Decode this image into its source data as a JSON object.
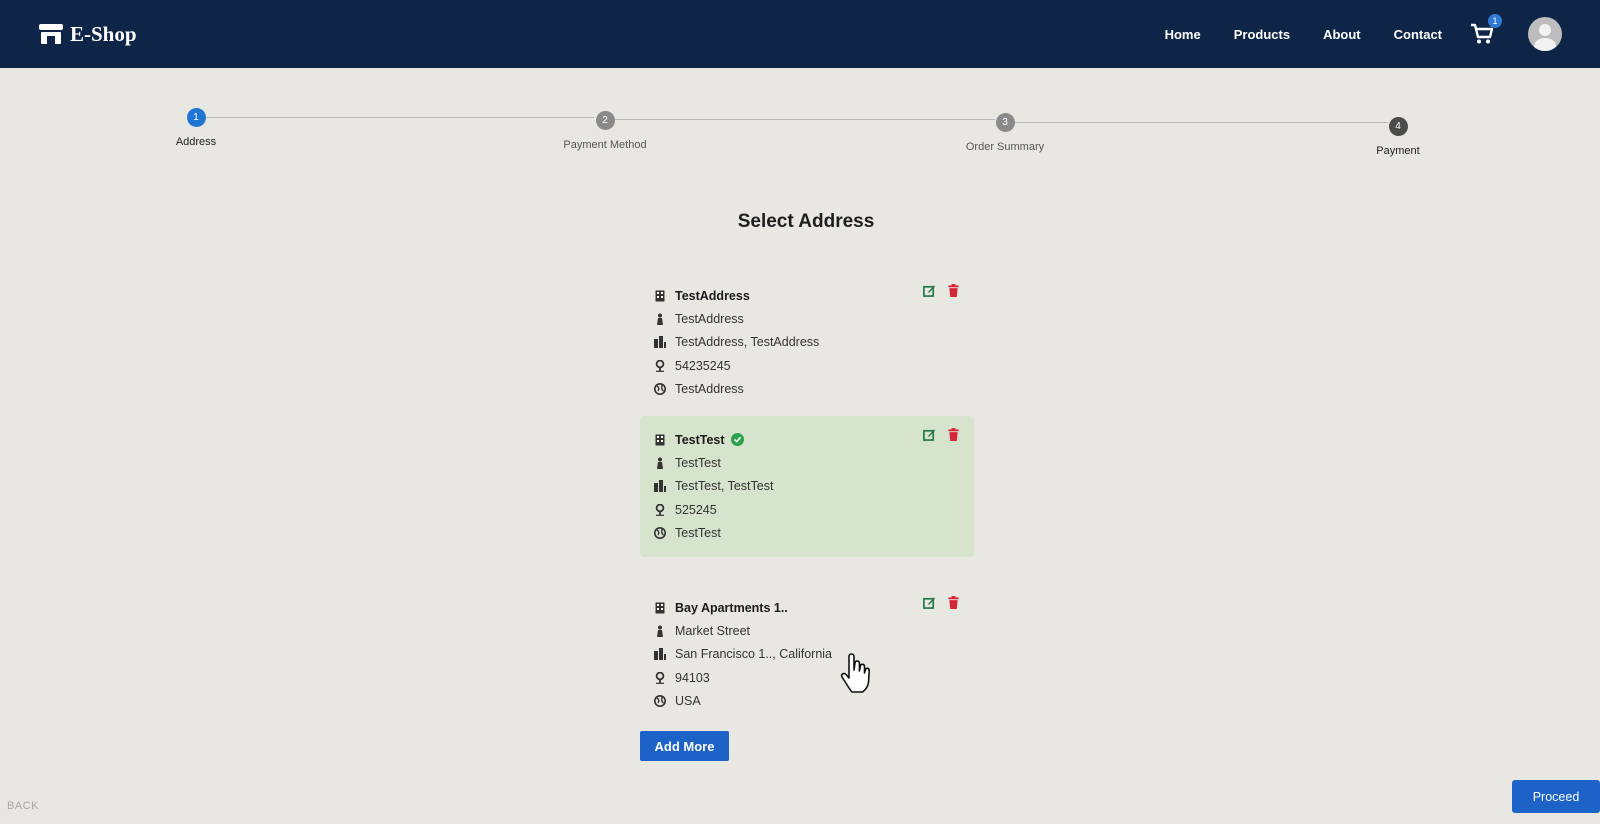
{
  "navbar": {
    "brand": "E-Shop",
    "links": [
      "Home",
      "Products",
      "About",
      "Contact"
    ],
    "cart_count": "1"
  },
  "stepper": {
    "steps": [
      {
        "number": "1",
        "label": "Address"
      },
      {
        "number": "2",
        "label": "Payment Method"
      },
      {
        "number": "3",
        "label": "Order Summary"
      },
      {
        "number": "4",
        "label": "Payment"
      }
    ]
  },
  "main": {
    "title": "Select Address",
    "addresses": [
      {
        "name": "TestAddress",
        "street": "TestAddress",
        "city_state": "TestAddress, TestAddress",
        "zip": "54235245",
        "country": "TestAddress",
        "selected": false
      },
      {
        "name": "TestTest",
        "street": "TestTest",
        "city_state": "TestTest, TestTest",
        "zip": "525245",
        "country": "TestTest",
        "selected": true
      },
      {
        "name": "Bay Apartments 1..",
        "street": "Market Street",
        "city_state": "San Francisco 1.., California",
        "zip": "94103",
        "country": "USA",
        "selected": false
      }
    ],
    "add_more_label": "Add More"
  },
  "footer": {
    "back_label": "BACK",
    "proceed_label": "Proceed"
  },
  "colors": {
    "navbar": "#0f2547",
    "primary": "#1d63c7",
    "active_step": "#1f76d2",
    "selected_card": "#d7e4cd",
    "edit_icon": "#1f7a45",
    "delete_icon": "#d6263a",
    "check": "#2ca24a"
  },
  "icons": {
    "brand": "shop-icon",
    "cart": "cart-icon",
    "avatar": "user-avatar-icon",
    "name": "building-icon",
    "street": "street-icon",
    "city": "city-icon",
    "zip": "map-pin-icon",
    "country": "globe-icon",
    "edit": "edit-icon",
    "delete": "trash-icon"
  }
}
